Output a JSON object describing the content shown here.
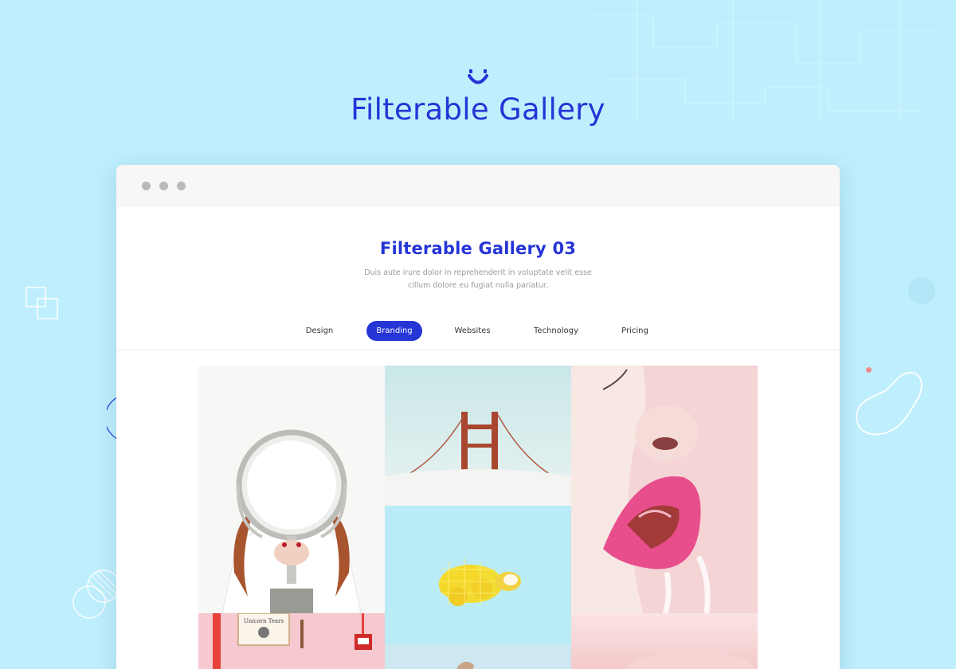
{
  "hero": {
    "title": "Filterable Gallery",
    "logo_icon": "smile-icon",
    "accent_color": "#2535d6"
  },
  "browser": {
    "window_dots": [
      "dot",
      "dot",
      "dot"
    ]
  },
  "gallery": {
    "title": "Filterable Gallery 03",
    "subtitle_line1": "Duis aute irure dolor in reprehenderit in voluptate velit esse",
    "subtitle_line2": "cillum dolore eu fugiat nulla pariatur.",
    "tabs": [
      {
        "label": "Design",
        "active": false
      },
      {
        "label": "Branding",
        "active": true
      },
      {
        "label": "Websites",
        "active": false
      },
      {
        "label": "Technology",
        "active": false
      },
      {
        "label": "Pricing",
        "active": false
      }
    ],
    "images": [
      {
        "subject": "woman-holding-mirror"
      },
      {
        "subject": "bridge-in-fog"
      },
      {
        "subject": "lips-with-candy"
      },
      {
        "subject": "lemons-in-net"
      },
      {
        "subject": "pink-wall-unicorn-sign",
        "text": "Unicorn Tears"
      },
      {
        "subject": "pink-clouds"
      },
      {
        "subject": "blue-still-life"
      }
    ]
  }
}
